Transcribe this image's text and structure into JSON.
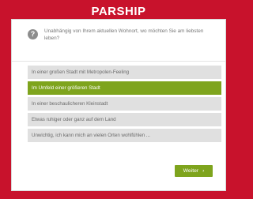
{
  "brand": {
    "logo_text": "PARSHIP"
  },
  "question": {
    "icon": "question-mark-icon",
    "text": "Unabhängig von Ihrem aktuellen Wohnort, wo möchten Sie am liebsten leben?"
  },
  "options": [
    {
      "label": "In einer großen Stadt mit Metropolen-Feeling",
      "selected": false
    },
    {
      "label": "Im Umfeld einer größeren Stadt",
      "selected": true
    },
    {
      "label": "In einer beschaulicheren Kleinstadt",
      "selected": false
    },
    {
      "label": "Etwas ruhiger oder ganz auf dem Land",
      "selected": false
    },
    {
      "label": "Unwichtig, ich kann mich an vielen Orten wohlfühlen ...",
      "selected": false
    }
  ],
  "actions": {
    "next_label": "Weiter",
    "next_icon": "chevron-right-icon"
  },
  "colors": {
    "brand_red": "#c8122c",
    "accent_green": "#7ea41d",
    "option_gray": "#e0e0e0"
  }
}
